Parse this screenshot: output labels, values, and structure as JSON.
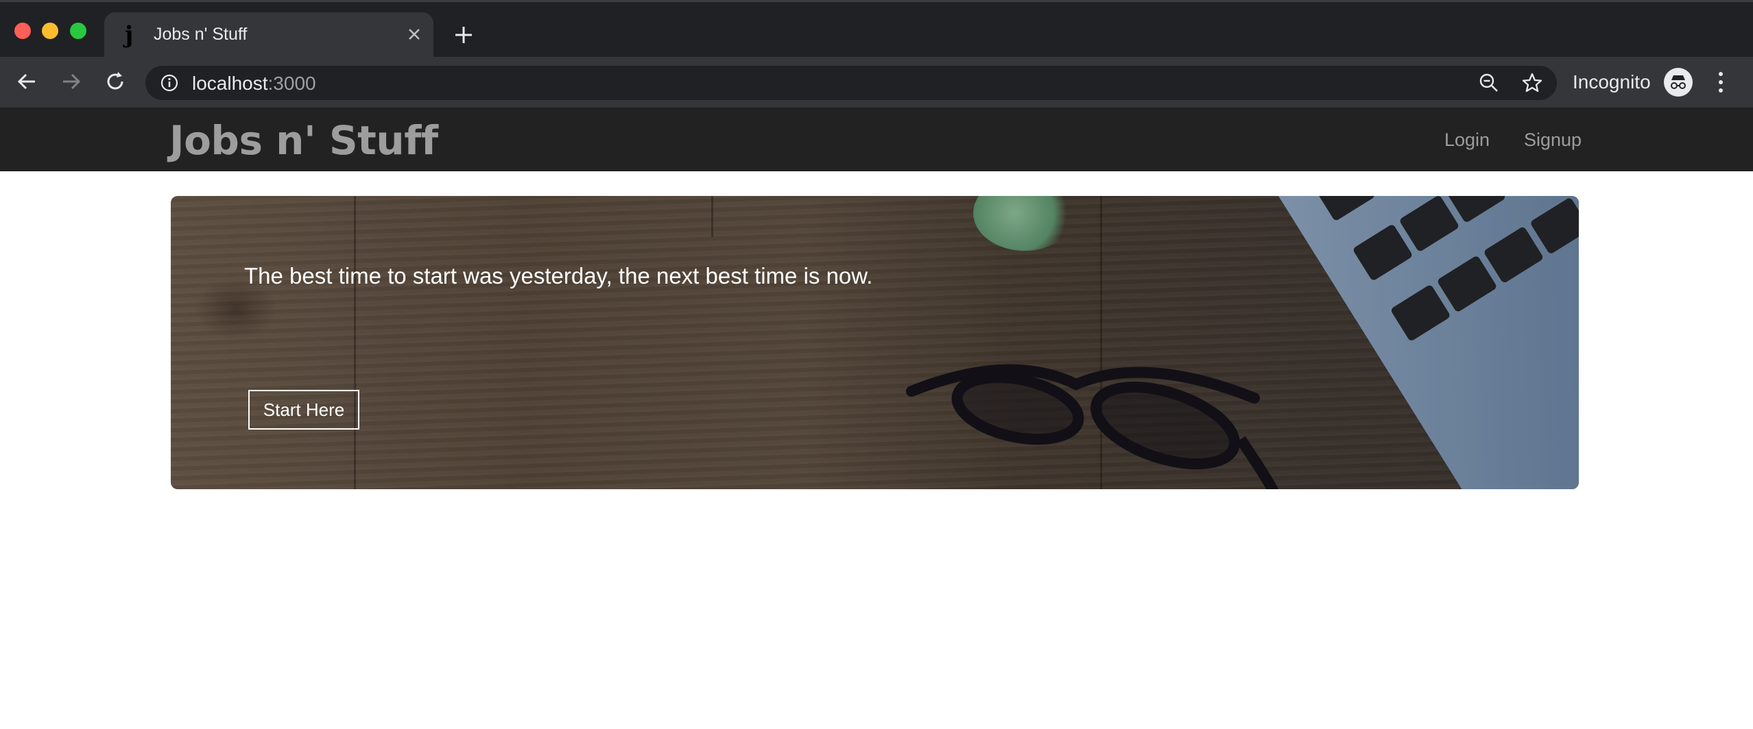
{
  "browser": {
    "tab": {
      "favicon": "j",
      "title": "Jobs n' Stuff"
    },
    "url": {
      "host": "localhost",
      "port": ":3000"
    },
    "profile_label": "Incognito",
    "icons": [
      "back-arrow-icon",
      "forward-arrow-icon",
      "reload-icon",
      "info-icon",
      "zoom-out-icon",
      "star-icon",
      "incognito-icon",
      "kebab-menu-icon",
      "close-icon",
      "plus-icon"
    ]
  },
  "site": {
    "brand": "Jobs n' Stuff",
    "nav": {
      "login": "Login",
      "signup": "Signup"
    },
    "hero": {
      "tagline": "The best time to start was yesterday, the next best time is now.",
      "cta": "Start Here"
    }
  }
}
